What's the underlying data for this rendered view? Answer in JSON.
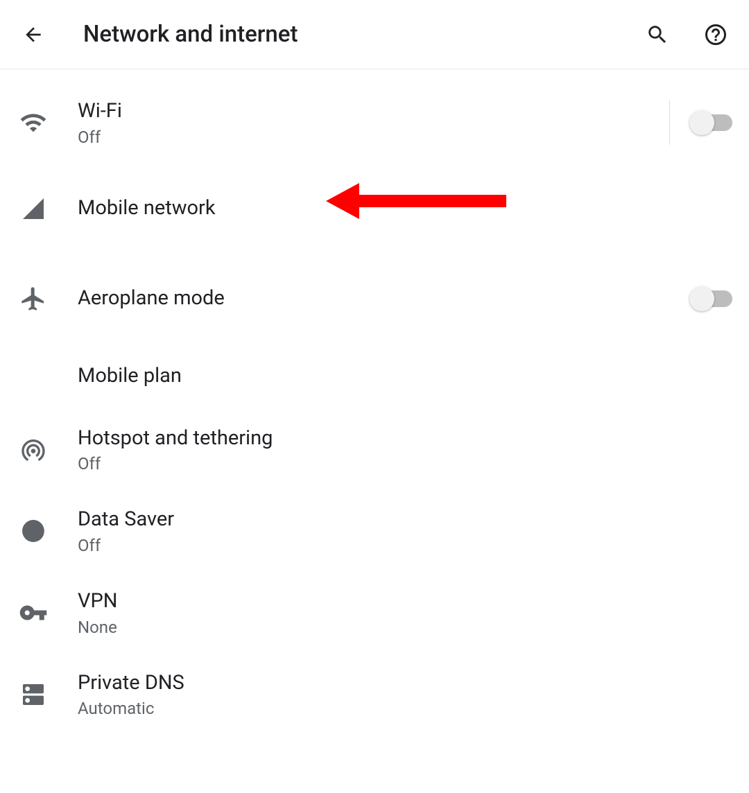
{
  "header": {
    "title": "Network and internet"
  },
  "items": {
    "wifi": {
      "title": "Wi-Fi",
      "status": "Off",
      "toggle_on": false
    },
    "mobile_network": {
      "title": "Mobile network"
    },
    "aeroplane_mode": {
      "title": "Aeroplane mode",
      "toggle_on": false
    },
    "mobile_plan": {
      "title": "Mobile plan"
    },
    "hotspot": {
      "title": "Hotspot and tethering",
      "status": "Off"
    },
    "data_saver": {
      "title": "Data Saver",
      "status": "Off"
    },
    "vpn": {
      "title": "VPN",
      "status": "None"
    },
    "private_dns": {
      "title": "Private DNS",
      "status": "Automatic"
    }
  },
  "annotation": {
    "arrow_points_to": "mobile_network"
  }
}
